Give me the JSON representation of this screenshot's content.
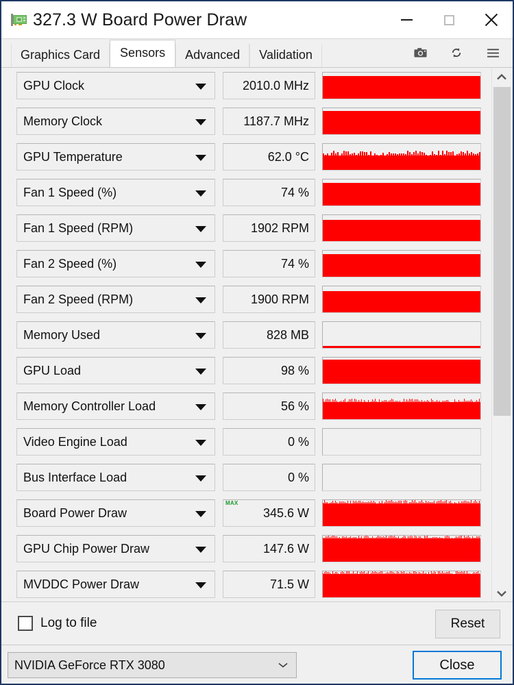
{
  "window": {
    "title": "327.3 W Board Power Draw",
    "icon": "graphics-card-icon",
    "minimize_label": "—",
    "maximize_label": "□",
    "close_label": "✕",
    "accent_color": "#1f3864",
    "graph_color": "#fe0000",
    "max_badge_color": "#1a9a2e",
    "focus_color": "#0078d7"
  },
  "tabs": [
    {
      "label": "Graphics Card",
      "active": false
    },
    {
      "label": "Sensors",
      "active": true
    },
    {
      "label": "Advanced",
      "active": false
    },
    {
      "label": "Validation",
      "active": false
    }
  ],
  "toolbar": {
    "icons": [
      {
        "name": "camera-icon",
        "glyph": "📷"
      },
      {
        "name": "refresh-icon",
        "glyph": "⟳"
      },
      {
        "name": "menu-icon",
        "glyph": "☰"
      }
    ]
  },
  "sensors": [
    {
      "name": "GPU Clock",
      "value": "2010.0 MHz",
      "max": false,
      "graph": "full",
      "fill": 88
    },
    {
      "name": "Memory Clock",
      "value": "1187.7 MHz",
      "max": false,
      "graph": "full",
      "fill": 90
    },
    {
      "name": "GPU Temperature",
      "value": "62.0 °C",
      "max": false,
      "graph": "jagged",
      "fill": 55
    },
    {
      "name": "Fan 1 Speed (%)",
      "value": "74 %",
      "max": false,
      "graph": "full",
      "fill": 86
    },
    {
      "name": "Fan 1 Speed (RPM)",
      "value": "1902 RPM",
      "max": false,
      "graph": "full",
      "fill": 82
    },
    {
      "name": "Fan 2 Speed (%)",
      "value": "74 %",
      "max": false,
      "graph": "full",
      "fill": 86
    },
    {
      "name": "Fan 2 Speed (RPM)",
      "value": "1900 RPM",
      "max": false,
      "graph": "full",
      "fill": 82
    },
    {
      "name": "Memory Used",
      "value": "828 MB",
      "max": false,
      "graph": "sliver",
      "fill": 7
    },
    {
      "name": "GPU Load",
      "value": "98 %",
      "max": false,
      "graph": "full",
      "fill": 92
    },
    {
      "name": "Memory Controller Load",
      "value": "56 %",
      "max": false,
      "graph": "dense",
      "fill": 66
    },
    {
      "name": "Video Engine Load",
      "value": "0 %",
      "max": false,
      "graph": "empty",
      "fill": 0
    },
    {
      "name": "Bus Interface Load",
      "value": "0 %",
      "max": false,
      "graph": "empty",
      "fill": 0
    },
    {
      "name": "Board Power Draw",
      "value": "345.6 W",
      "max": true,
      "graph": "dense",
      "fill": 87
    },
    {
      "name": "GPU Chip Power Draw",
      "value": "147.6 W",
      "max": false,
      "graph": "dense",
      "fill": 90
    },
    {
      "name": "MVDDC Power Draw",
      "value": "71.5 W",
      "max": false,
      "graph": "dense",
      "fill": 90
    }
  ],
  "max_badge_text": "MAX",
  "scrollbar": {
    "up_arrow": "ⱏ",
    "down_arrow": "ⱟ"
  },
  "footer": {
    "log_to_file_label": "Log to file",
    "log_to_file_checked": false,
    "reset_label": "Reset",
    "gpu_selected": "NVIDIA GeForce RTX 3080",
    "gpu_chevron": "⌄",
    "close_label": "Close"
  }
}
